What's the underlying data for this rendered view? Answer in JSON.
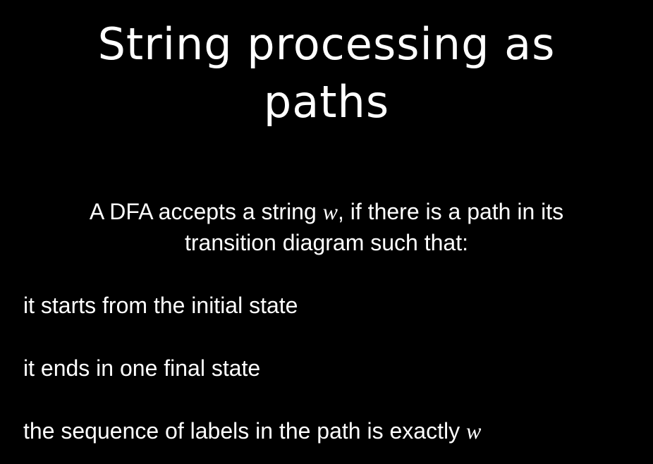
{
  "slide": {
    "title_line1": "String processing as",
    "title_line2": "paths",
    "intro_line1_before": "A DFA accepts a string ",
    "intro_var": "w",
    "intro_line1_after": ", if there is a path in its",
    "intro_line2": "transition diagram such that:",
    "bullets": [
      {
        "text": "it starts from the initial state"
      },
      {
        "text": "it ends in one final state"
      },
      {
        "text": "the sequence of labels in the path is exactly ",
        "var": "w"
      }
    ]
  },
  "colors": {
    "background": "#000000",
    "text": "#ffffff"
  }
}
